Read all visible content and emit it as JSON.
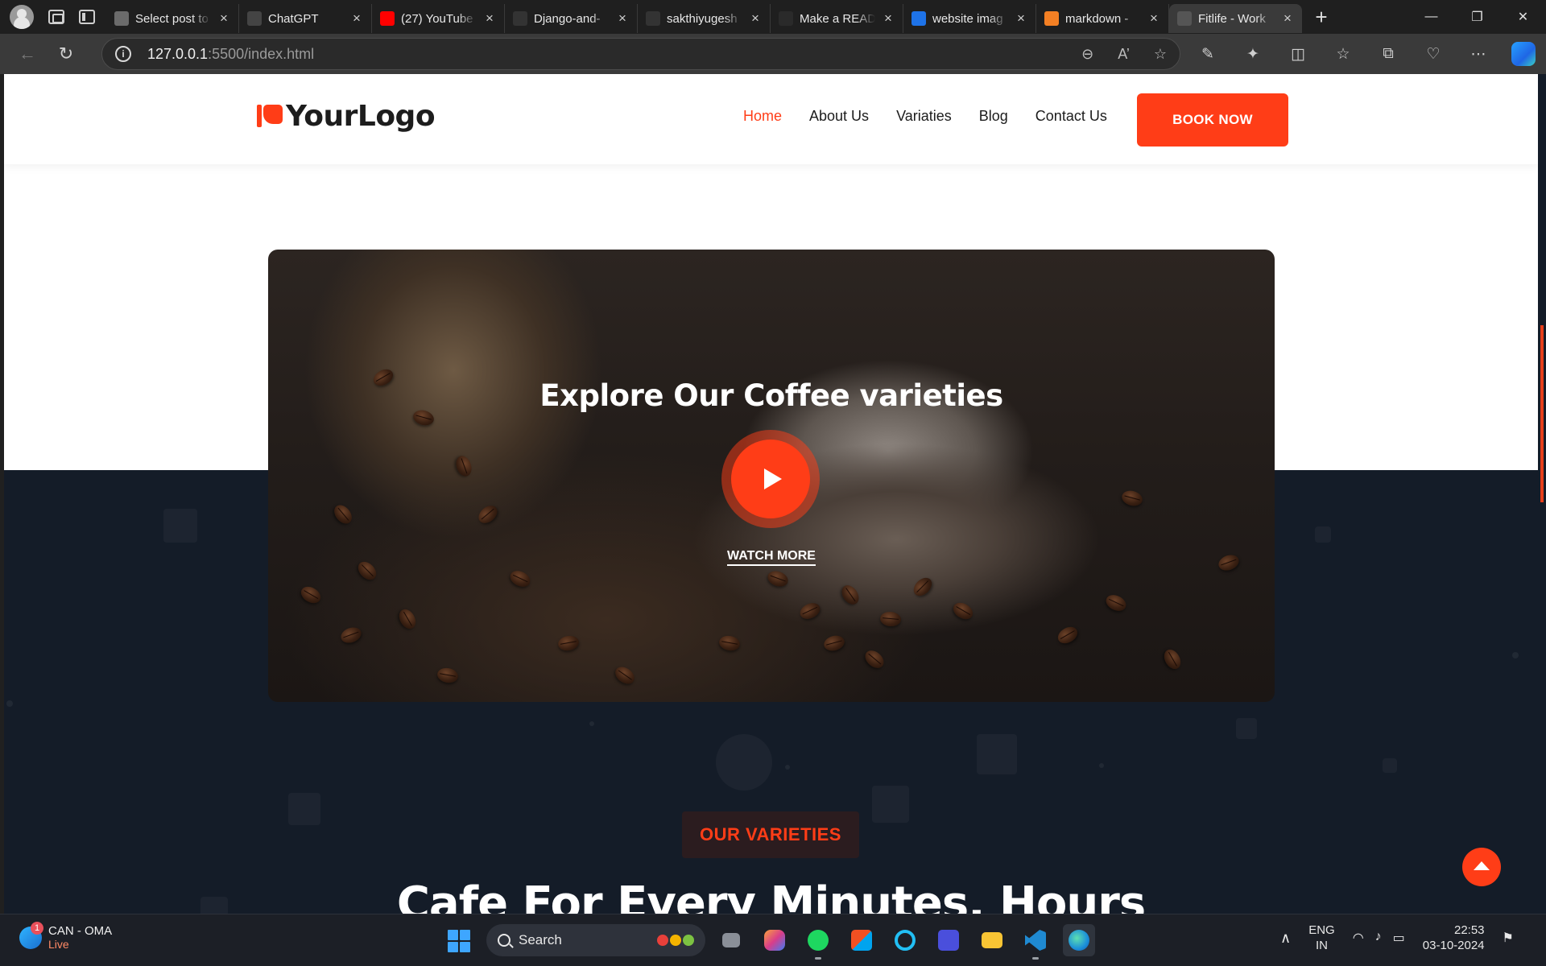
{
  "browser": {
    "tabs": [
      {
        "title": "Select post to",
        "favicon": "document-icon",
        "color": "#6b6b6b"
      },
      {
        "title": "ChatGPT",
        "favicon": "chatgpt-icon",
        "color": "#444444"
      },
      {
        "title": "(27) YouTube",
        "favicon": "youtube-icon",
        "color": "#ff0000"
      },
      {
        "title": "Django-and-",
        "favicon": "github-icon",
        "color": "#333333"
      },
      {
        "title": "sakthiyugesh",
        "favicon": "github-icon",
        "color": "#333333"
      },
      {
        "title": "Make a READ",
        "favicon": "document-icon",
        "color": "#2a2a2a"
      },
      {
        "title": "website imag",
        "favicon": "search-icon",
        "color": "#1e73e8"
      },
      {
        "title": "markdown - ",
        "favicon": "stackoverflow-icon",
        "color": "#f48024"
      },
      {
        "title": "Fitlife - Work",
        "favicon": "broadcast-icon",
        "color": "#555555"
      }
    ],
    "active_tab_index": 8,
    "url_host": "127.0.0.1",
    "url_path": ":5500/index.html"
  },
  "site": {
    "logo_text": "YourLogo",
    "nav": [
      {
        "label": "Home",
        "active": true
      },
      {
        "label": "About Us",
        "active": false
      },
      {
        "label": "Variaties",
        "active": false
      },
      {
        "label": "Blog",
        "active": false
      },
      {
        "label": "Contact Us",
        "active": false
      }
    ],
    "book_button": "BOOK NOW",
    "video": {
      "title": "Explore Our Coffee varieties",
      "watch_more": "WATCH MORE"
    },
    "section_badge": "OUR VARIETIES",
    "section_heading": "Cafe For Every Minutes, Hours",
    "accent_color": "#ff3d17",
    "dark_bg": "#141c28"
  },
  "taskbar": {
    "weather_title": "CAN - OMA",
    "weather_sub": "Live",
    "weather_badge": "1",
    "search_label": "Search",
    "lang_top": "ENG",
    "lang_bottom": "IN",
    "time": "22:53",
    "date": "03-10-2024"
  }
}
